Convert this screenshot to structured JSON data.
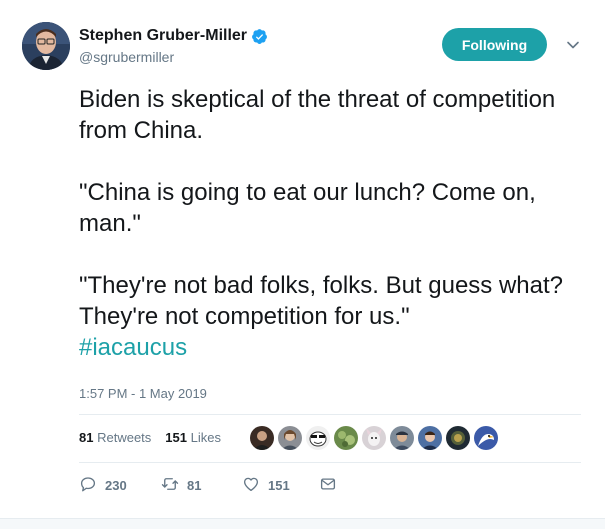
{
  "author": {
    "name": "Stephen Gruber-Miller",
    "handle": "@sgrubermiller"
  },
  "follow_button": {
    "label": "Following"
  },
  "tweet": {
    "paragraphs": [
      "Biden is skeptical of the threat of competition from China.",
      "\"China is going to eat our lunch? Come on, man.\"",
      "\"They're not bad folks, folks. But guess what? They're not competition for us.\""
    ],
    "hashtag": "#iacaucus",
    "timestamp": "1:57 PM - 1 May 2019"
  },
  "stats": {
    "retweets_count": "81",
    "retweets_label": "Retweets",
    "likes_count": "151",
    "likes_label": "Likes"
  },
  "liker_avatars": [
    "liker-1",
    "liker-2",
    "liker-3",
    "liker-4",
    "liker-5",
    "liker-6",
    "liker-7",
    "liker-8",
    "liker-9"
  ],
  "actions": {
    "reply_count": "230",
    "retweet_count": "81",
    "like_count": "151"
  },
  "colors": {
    "accent": "#1da1a8",
    "secondary_text": "#657786",
    "verified": "#1da1f2"
  },
  "icons": {
    "verified": "verified-badge-icon",
    "caret": "chevron-down-icon",
    "reply": "reply-icon",
    "retweet": "retweet-icon",
    "like": "heart-icon",
    "dm": "envelope-icon"
  }
}
